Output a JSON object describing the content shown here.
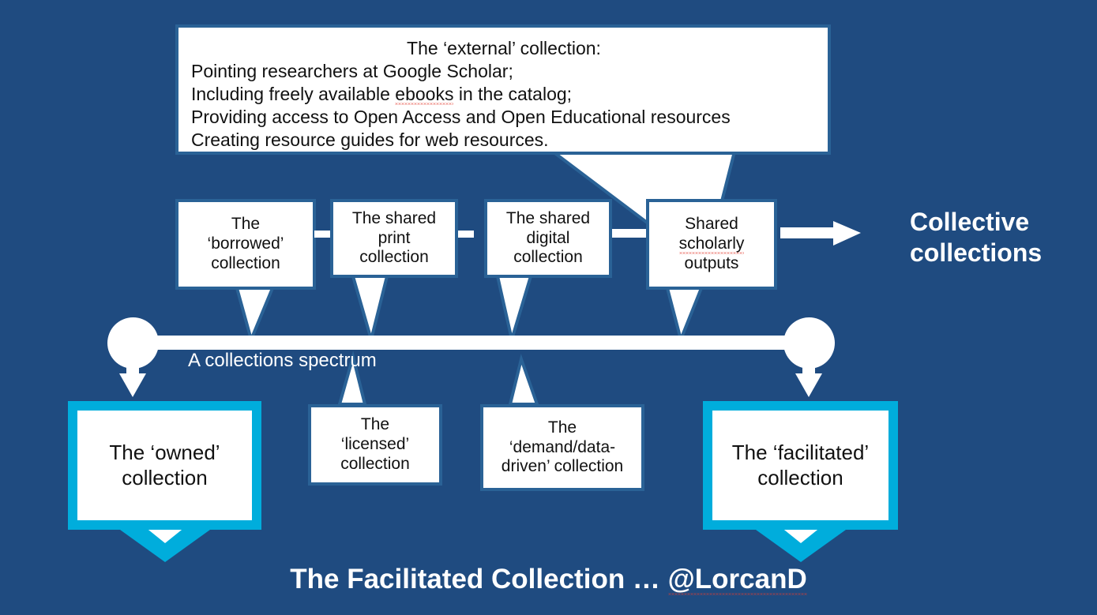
{
  "theme": {
    "background": "#1f4b80",
    "box_border": "#2a6296",
    "box_fill": "#ffffff",
    "accent_cyan": "#00addc",
    "text_white": "#ffffff",
    "text_dark": "#111111",
    "spellcheck_red": "#e23b2e"
  },
  "external_callout": {
    "heading": "The ‘external’ collection:",
    "lines": [
      "Pointing researchers at Google Scholar;",
      "Including freely available ebooks in the catalog;",
      "Providing access to Open Access and Open Educational resources",
      "Creating resource guides for web resources."
    ],
    "line2_pre": "Including freely available ",
    "line2_misspelled": "ebooks",
    "line2_post": " in the catalog;"
  },
  "spectrum": {
    "label": "A collections spectrum",
    "top_boxes": [
      {
        "label": "The\n‘borrowed’\ncollection",
        "line1": "The",
        "line2": "‘borrowed’",
        "line3": "collection"
      },
      {
        "label": "The shared\nprint\ncollection",
        "line1": "The shared",
        "line2": "print",
        "line3": "collection"
      },
      {
        "label": "The shared\ndigital\ncollection",
        "line1": "The shared",
        "line2": "digital",
        "line3": "collection"
      },
      {
        "label": "Shared\nscholarly\noutputs",
        "line1": "Shared",
        "line2": "scholarly",
        "line3": "outputs"
      }
    ],
    "bottom_boxes": [
      {
        "line1": "The ‘owned’",
        "line2": "collection"
      },
      {
        "line1": "The",
        "line2": "‘licensed’",
        "line3": "collection"
      },
      {
        "line1": "The",
        "line2": "‘demand/data-",
        "line3": "driven’ collection"
      },
      {
        "line1": "The ‘facilitated’",
        "line2": "collection"
      }
    ]
  },
  "collective": {
    "line1": "Collective",
    "line2": "collections"
  },
  "page_title": {
    "prefix": "The Facilitated Collection … ",
    "handle": "@LorcanD"
  }
}
